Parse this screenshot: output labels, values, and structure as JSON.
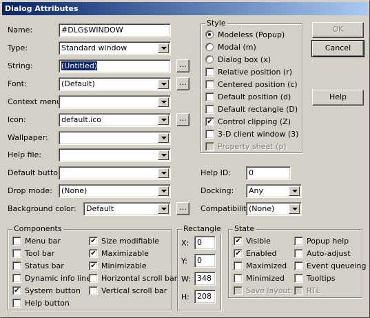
{
  "window": {
    "title": "Dialog Attributes"
  },
  "fields": {
    "name": {
      "label": "Name:",
      "value": "#DLG$WINDOW"
    },
    "type": {
      "label": "Type:",
      "value": "Standard window"
    },
    "string": {
      "label": "String:",
      "value": "(Untitled)"
    },
    "font": {
      "label": "Font:",
      "value": "(Default)"
    },
    "context_menu": {
      "label": "Context menu:",
      "value": ""
    },
    "icon": {
      "label": "Icon:",
      "value": "default.ico"
    },
    "wallpaper": {
      "label": "Wallpaper:",
      "value": ""
    },
    "help_file": {
      "label": "Help file:",
      "value": ""
    },
    "default_button": {
      "label": "Default button:",
      "value": ""
    },
    "drop_mode": {
      "label": "Drop mode:",
      "value": "(None)"
    },
    "background_color": {
      "label": "Background color:",
      "value": "Default"
    },
    "help_id": {
      "label": "Help ID:",
      "value": "0"
    },
    "docking": {
      "label": "Docking:",
      "value": "Any"
    },
    "compatibility": {
      "label": "Compatibility:",
      "value": "(None)"
    }
  },
  "browse_label": "...",
  "buttons": {
    "ok": "OK",
    "cancel": "Cancel",
    "help": "Help"
  },
  "style": {
    "title": "Style",
    "radios": [
      {
        "label": "Modeless (Popup)",
        "selected": true
      },
      {
        "label": "Modal (m)",
        "selected": false
      },
      {
        "label": "Dialog box (x)",
        "selected": false
      }
    ],
    "checks": [
      {
        "label": "Relative position (r)",
        "checked": false,
        "disabled": false
      },
      {
        "label": "Centered position (c)",
        "checked": false,
        "disabled": false
      },
      {
        "label": "Default position (d)",
        "checked": false,
        "disabled": false
      },
      {
        "label": "Default rectangle (D)",
        "checked": false,
        "disabled": false
      },
      {
        "label": "Control clipping (Z)",
        "checked": true,
        "disabled": false
      },
      {
        "label": "3-D client window (3)",
        "checked": false,
        "disabled": false
      },
      {
        "label": "Property sheet (p)",
        "checked": false,
        "disabled": true
      }
    ]
  },
  "components": {
    "title": "Components",
    "left": [
      {
        "label": "Menu bar",
        "checked": false
      },
      {
        "label": "Tool bar",
        "checked": false
      },
      {
        "label": "Status bar",
        "checked": false
      },
      {
        "label": "Dynamic info line",
        "checked": false
      },
      {
        "label": "System button",
        "checked": true
      },
      {
        "label": "Help button",
        "checked": false
      }
    ],
    "right": [
      {
        "label": "Size modifiable",
        "checked": true
      },
      {
        "label": "Maximizable",
        "checked": true
      },
      {
        "label": "Minimizable",
        "checked": true
      },
      {
        "label": "Horizontal scroll bar",
        "checked": false
      },
      {
        "label": "Vertical scroll bar",
        "checked": false
      }
    ]
  },
  "rectangle": {
    "title": "Rectangle",
    "x_label": "X:",
    "x": "0",
    "y_label": "Y:",
    "y": "0",
    "w_label": "W:",
    "w": "348",
    "h_label": "H:",
    "h": "208"
  },
  "state": {
    "title": "State",
    "left": [
      {
        "label": "Visible",
        "checked": true,
        "disabled": false
      },
      {
        "label": "Enabled",
        "checked": true,
        "disabled": false
      },
      {
        "label": "Maximized",
        "checked": false,
        "disabled": false
      },
      {
        "label": "Minimized",
        "checked": false,
        "disabled": false
      },
      {
        "label": "Save layout",
        "checked": false,
        "disabled": true
      }
    ],
    "right": [
      {
        "label": "Popup help",
        "checked": false,
        "disabled": false
      },
      {
        "label": "Auto-adjust",
        "checked": false,
        "disabled": false
      },
      {
        "label": "Event queueing",
        "checked": false,
        "disabled": false
      },
      {
        "label": "Tooltips",
        "checked": false,
        "disabled": false
      },
      {
        "label": "RTL",
        "checked": false,
        "disabled": true
      }
    ]
  },
  "colors": {
    "title_start": "#0a246a",
    "title_end": "#a6caf0",
    "face": "#d4d0c8"
  }
}
